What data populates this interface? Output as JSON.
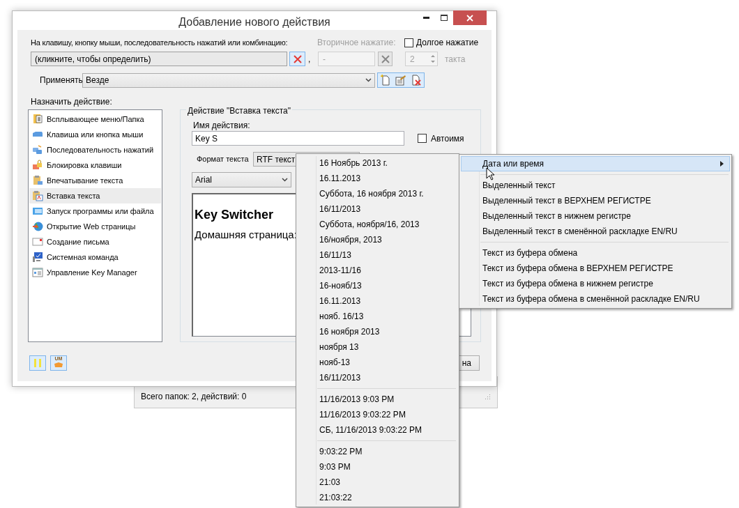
{
  "dialog": {
    "title": "Добавление нового действия",
    "trigger": {
      "label": "На клавишу, кнопку мыши, последовательность нажатий или комбинацию:",
      "value": "(кликните, чтобы определить)",
      "separator": ","
    },
    "secondary": {
      "label": "Вторичное нажатие:",
      "value": "-",
      "disabled": true
    },
    "long_press": {
      "label": "Долгое нажатие",
      "checked": false,
      "count": "2",
      "unit": "такта",
      "disabled": true
    },
    "apply": {
      "label": "Применять",
      "value": "Везде"
    },
    "assign_label": "Назначить действие:",
    "actions": [
      {
        "label": "Всплывающее меню/Папка",
        "selected": false
      },
      {
        "label": "Клавиша или кнопка мыши",
        "selected": false
      },
      {
        "label": "Последовательность нажатий",
        "selected": false
      },
      {
        "label": "Блокировка клавиши",
        "selected": false
      },
      {
        "label": "Впечатывание текста",
        "selected": false
      },
      {
        "label": "Вставка текста",
        "selected": true
      },
      {
        "label": "Запуск программы или файла",
        "selected": false
      },
      {
        "label": "Открытие Web страницы",
        "selected": false
      },
      {
        "label": "Создание письма",
        "selected": false
      },
      {
        "label": "Системная команда",
        "selected": false
      },
      {
        "label": "Управление Key Manager",
        "selected": false
      }
    ],
    "group": {
      "legend": "Действие \"Вставка текста\"",
      "name_label": "Имя действия:",
      "name_value": "Key S",
      "auto_name": {
        "label": "Автоимя",
        "checked": false
      },
      "format_label": "Формат текста",
      "format_value": "RTF текст",
      "font": "Arial",
      "content": [
        {
          "kind": "heading",
          "text": "Key Switcher"
        },
        {
          "kind": "paragraph",
          "text": "Домашняя страница:"
        }
      ]
    },
    "um_button": "UM",
    "cancel_button": "на"
  },
  "status_bar": "Всего папок: 2, действий: 0",
  "date_menu": [
    {
      "kind": "item",
      "label": "16 Ноябрь 2013 г."
    },
    {
      "kind": "item",
      "label": "16.11.2013"
    },
    {
      "kind": "item",
      "label": "Суббота, 16 ноября 2013 г."
    },
    {
      "kind": "item",
      "label": "16/11/2013"
    },
    {
      "kind": "item",
      "label": "Суббота, ноября/16, 2013"
    },
    {
      "kind": "item",
      "label": "16/ноября, 2013"
    },
    {
      "kind": "item",
      "label": "16/11/13"
    },
    {
      "kind": "item",
      "label": "2013-11/16"
    },
    {
      "kind": "item",
      "label": "16-нояб/13"
    },
    {
      "kind": "item",
      "label": "16.11.2013"
    },
    {
      "kind": "item",
      "label": "нояб. 16/13"
    },
    {
      "kind": "item",
      "label": "16 ноября 2013"
    },
    {
      "kind": "item",
      "label": "ноября 13"
    },
    {
      "kind": "item",
      "label": "нояб-13"
    },
    {
      "kind": "item",
      "label": "16/11/2013"
    },
    {
      "kind": "separator"
    },
    {
      "kind": "item",
      "label": "11/16/2013 9:03 PM"
    },
    {
      "kind": "item",
      "label": "11/16/2013 9:03:22 PM"
    },
    {
      "kind": "item",
      "label": "СБ, 11/16/2013 9:03:22 PM"
    },
    {
      "kind": "separator"
    },
    {
      "kind": "item",
      "label": "9:03:22 PM"
    },
    {
      "kind": "item",
      "label": "9:03 PM"
    },
    {
      "kind": "item",
      "label": "21:03"
    },
    {
      "kind": "item",
      "label": "21:03:22"
    }
  ],
  "insert_menu": [
    {
      "kind": "item",
      "label": "Дата или время",
      "selected": true,
      "submenu": true
    },
    {
      "kind": "separator"
    },
    {
      "kind": "item",
      "label": "Выделенный текст",
      "selected": false,
      "submenu": false
    },
    {
      "kind": "item",
      "label": "Выделенный текст в ВЕРХНЕМ РЕГИСТРЕ",
      "selected": false,
      "submenu": false
    },
    {
      "kind": "item",
      "label": "Выделенный текст в нижнем регистре",
      "selected": false,
      "submenu": false
    },
    {
      "kind": "item",
      "label": "Выделенный текст в сменённой раскладке EN/RU",
      "selected": false,
      "submenu": false
    },
    {
      "kind": "separator"
    },
    {
      "kind": "item",
      "label": "Текст из буфера обмена",
      "selected": false,
      "submenu": false
    },
    {
      "kind": "item",
      "label": "Текст из буфера обмена в ВЕРХНЕМ РЕГИСТРЕ",
      "selected": false,
      "submenu": false
    },
    {
      "kind": "item",
      "label": "Текст из буфера обмена в нижнем регистре",
      "selected": false,
      "submenu": false
    },
    {
      "kind": "item",
      "label": "Текст из буфера обмена в сменённой раскладке EN/RU",
      "selected": false,
      "submenu": false
    }
  ]
}
